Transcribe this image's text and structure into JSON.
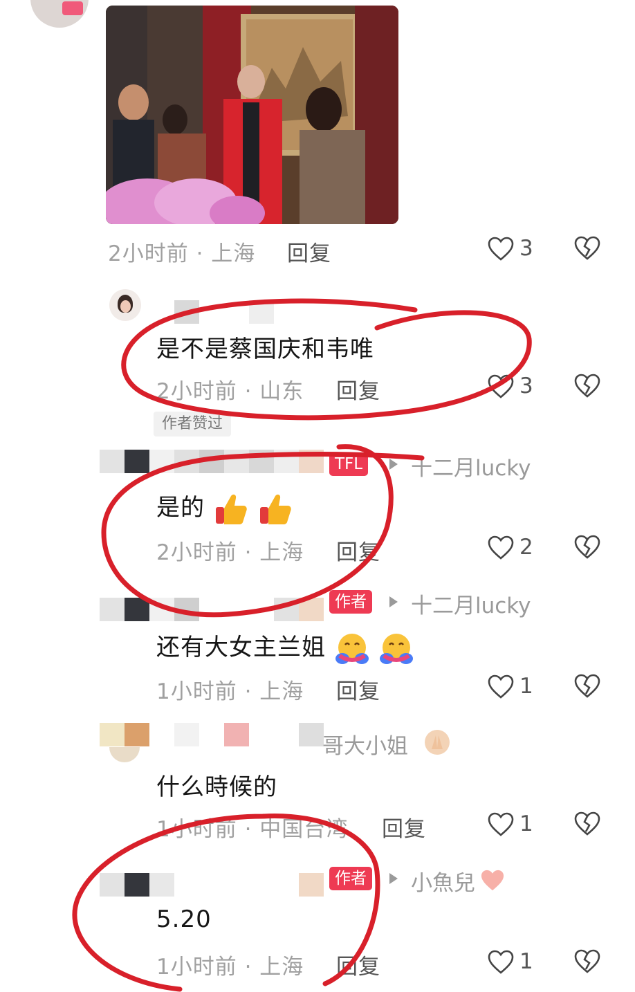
{
  "comments": [
    {
      "time_location": "2小时前 · 上海",
      "reply_label": "回复",
      "likes": "3"
    },
    {
      "text": "是不是蔡国庆和韦唯",
      "time_location": "2小时前 · 山东",
      "reply_label": "回复",
      "likes": "3",
      "liked_tag": "作者赞过"
    },
    {
      "badge": "TFL",
      "reply_to": "十二月lucky",
      "text": "是的",
      "time_location": "2小时前 · 上海",
      "reply_label": "回复",
      "likes": "2"
    },
    {
      "badge": "作者",
      "reply_to": "十二月lucky",
      "text": "还有大女主兰姐",
      "time_location": "1小时前 · 上海",
      "reply_label": "回复",
      "likes": "1"
    },
    {
      "username": "哥大小姐",
      "text": "什么時候的",
      "time_location": "1小时前 · 中国台湾",
      "reply_label": "回复",
      "likes": "1"
    },
    {
      "badge": "作者",
      "reply_to": "小魚兒",
      "text": "5.20",
      "time_location": "1小时前 · 上海",
      "reply_label": "回复",
      "likes": "1"
    }
  ],
  "icons": {
    "like": "heart-outline-icon",
    "dislike": "broken-heart-icon"
  },
  "colors": {
    "annotation": "#d8202a",
    "author_badge": "#ee3a53",
    "meta_text": "#a0a0a0"
  }
}
